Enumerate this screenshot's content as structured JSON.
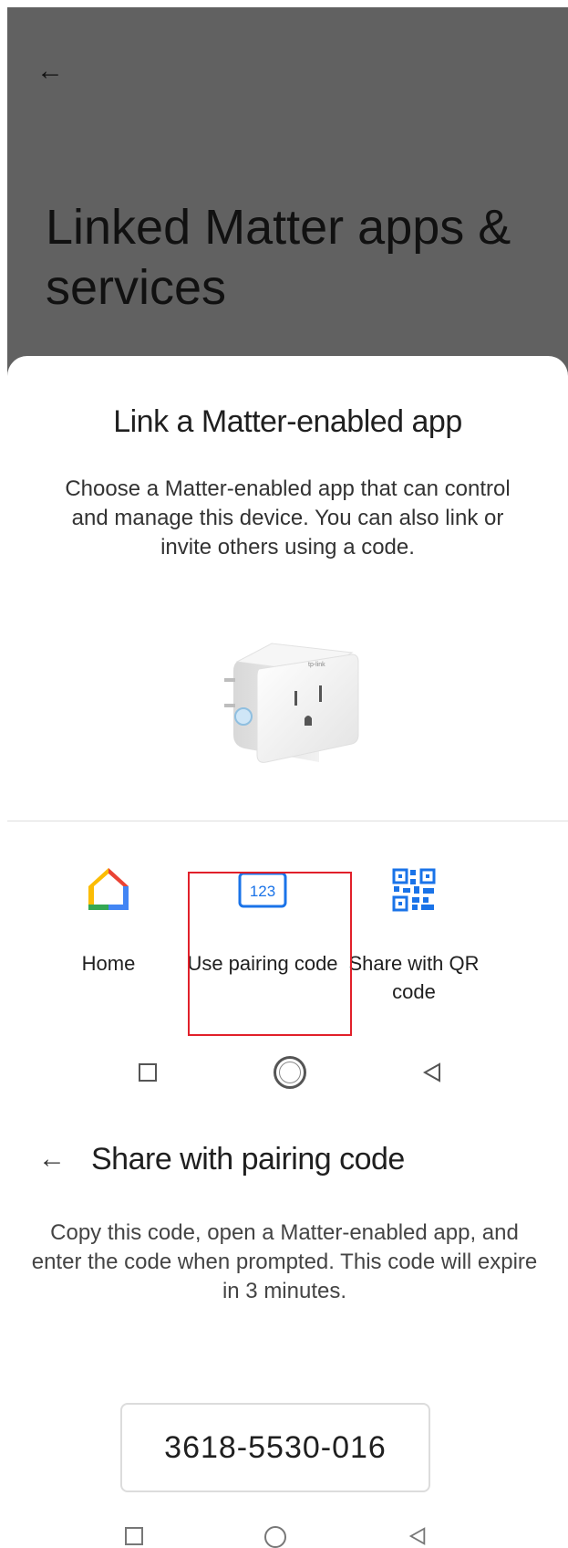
{
  "screen1": {
    "page_title": "Linked Matter apps & services",
    "sheet": {
      "title": "Link a Matter-enabled app",
      "description": "Choose a Matter-enabled app that can control and manage this device. You can also link or invite others using a code.",
      "options": [
        {
          "label": "Home",
          "icon": "google-home-icon"
        },
        {
          "label": "Use pairing code",
          "icon": "pairing-code-icon",
          "icon_text": "123"
        },
        {
          "label": "Share with QR code",
          "icon": "qr-code-icon"
        }
      ]
    }
  },
  "screen2": {
    "title": "Share with pairing code",
    "description": "Copy this code, open a Matter-enabled app, and enter the code when prompted. This code will expire in 3 minutes.",
    "code": "3618-5530-016"
  },
  "colors": {
    "accent_blue": "#1a73e8",
    "highlight_red": "#e1202a",
    "dim_overlay": "#616161"
  }
}
